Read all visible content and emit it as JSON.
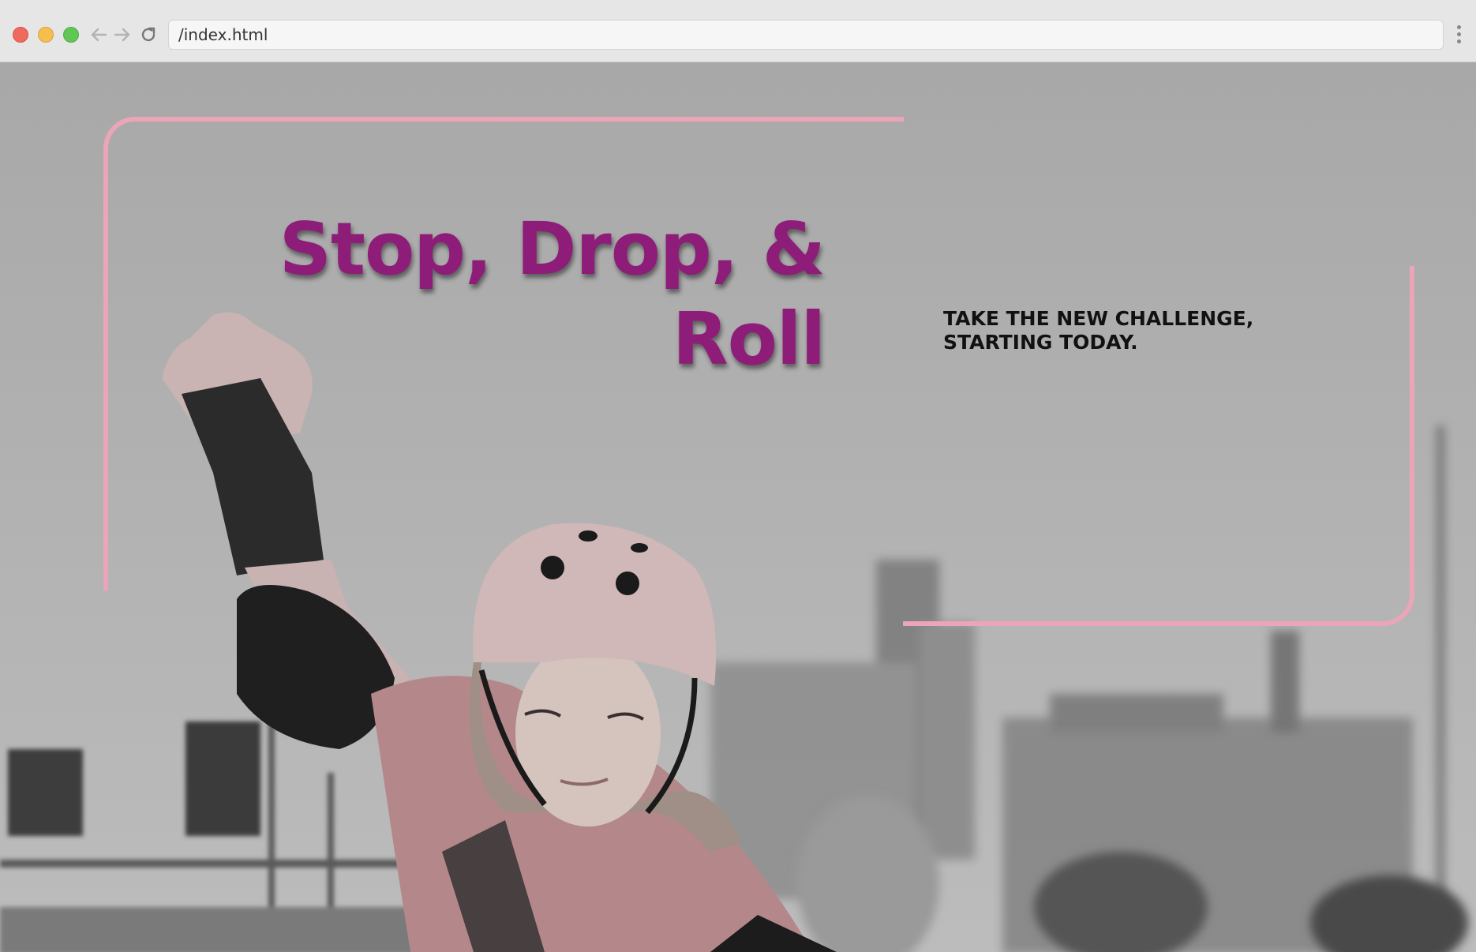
{
  "browser": {
    "url": "/index.html",
    "icons": {
      "back": "arrow-left-icon",
      "forward": "arrow-right-icon",
      "reload": "reload-icon",
      "menu": "kebab-menu-icon"
    }
  },
  "hero": {
    "headline_line1": "Stop, Drop, &",
    "headline_line2": "Roll",
    "tagline_line1": "TAKE THE NEW CHALLENGE,",
    "tagline_line2": "STARTING TODAY.",
    "background_image": "roller skater in helmet and pads, city buildings behind, desaturated with pink tint",
    "colors": {
      "headline": "#8d1d78",
      "frame": "#eaa6b8",
      "tagline": "#111111"
    }
  }
}
